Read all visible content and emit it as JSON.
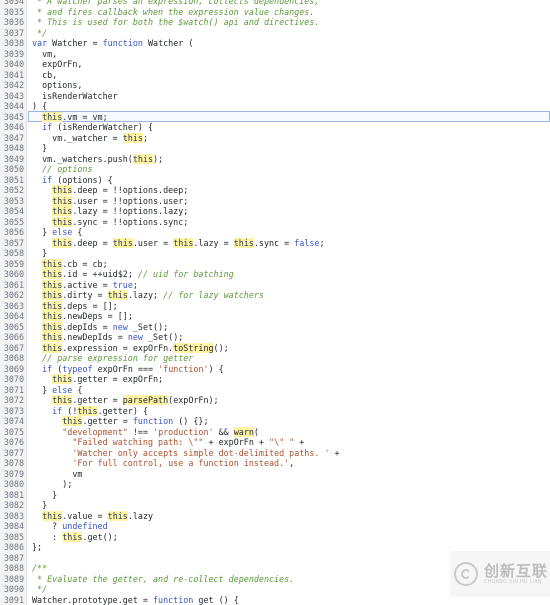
{
  "editor": {
    "lines": [
      {
        "num": "3034",
        "tokens": [
          [
            "t-comment",
            " * A watcher parses an expression, collects dependencies,"
          ]
        ]
      },
      {
        "num": "3035",
        "tokens": [
          [
            "t-comment",
            " * and fires callback when the expression value changes."
          ]
        ]
      },
      {
        "num": "3036",
        "tokens": [
          [
            "t-comment",
            " * This is used for both the $watch() api and directives."
          ]
        ]
      },
      {
        "num": "3037",
        "tokens": [
          [
            "t-comment",
            " */"
          ]
        ]
      },
      {
        "num": "3038",
        "tokens": [
          [
            "t-kw",
            "var"
          ],
          [
            "t-plain",
            " Watcher = "
          ],
          [
            "t-kw",
            "function"
          ],
          [
            "t-plain",
            " Watcher ("
          ]
        ]
      },
      {
        "num": "3039",
        "tokens": [
          [
            "t-plain",
            "  vm,"
          ]
        ]
      },
      {
        "num": "3040",
        "tokens": [
          [
            "t-plain",
            "  expOrFn,"
          ]
        ]
      },
      {
        "num": "3041",
        "tokens": [
          [
            "t-plain",
            "  cb,"
          ]
        ]
      },
      {
        "num": "3042",
        "tokens": [
          [
            "t-plain",
            "  options,"
          ]
        ]
      },
      {
        "num": "3043",
        "tokens": [
          [
            "t-plain",
            "  isRenderWatcher"
          ]
        ]
      },
      {
        "num": "3044",
        "tokens": [
          [
            "t-plain",
            ") {"
          ]
        ]
      },
      {
        "num": "3045",
        "hl": true,
        "tokens": [
          [
            "t-plain",
            "  "
          ],
          [
            "t-this",
            "this"
          ],
          [
            "t-plain",
            ".vm = vm;"
          ]
        ]
      },
      {
        "num": "3046",
        "tokens": [
          [
            "t-plain",
            "  "
          ],
          [
            "t-kw",
            "if"
          ],
          [
            "t-plain",
            " (isRenderWatcher) {"
          ]
        ]
      },
      {
        "num": "3047",
        "tokens": [
          [
            "t-plain",
            "    vm._watcher = "
          ],
          [
            "t-this",
            "this"
          ],
          [
            "t-plain",
            ";"
          ]
        ]
      },
      {
        "num": "3048",
        "tokens": [
          [
            "t-plain",
            "  }"
          ]
        ]
      },
      {
        "num": "3049",
        "tokens": [
          [
            "t-plain",
            "  vm._watchers.push("
          ],
          [
            "t-this",
            "this"
          ],
          [
            "t-plain",
            ");"
          ]
        ]
      },
      {
        "num": "3050",
        "tokens": [
          [
            "t-comment",
            "  // options"
          ]
        ]
      },
      {
        "num": "3051",
        "tokens": [
          [
            "t-plain",
            "  "
          ],
          [
            "t-kw",
            "if"
          ],
          [
            "t-plain",
            " (options) {"
          ]
        ]
      },
      {
        "num": "3052",
        "tokens": [
          [
            "t-plain",
            "    "
          ],
          [
            "t-this",
            "this"
          ],
          [
            "t-plain",
            ".deep = !!options.deep;"
          ]
        ]
      },
      {
        "num": "3053",
        "tokens": [
          [
            "t-plain",
            "    "
          ],
          [
            "t-this",
            "this"
          ],
          [
            "t-plain",
            ".user = !!options.user;"
          ]
        ]
      },
      {
        "num": "3054",
        "tokens": [
          [
            "t-plain",
            "    "
          ],
          [
            "t-this",
            "this"
          ],
          [
            "t-plain",
            ".lazy = !!options.lazy;"
          ]
        ]
      },
      {
        "num": "3055",
        "tokens": [
          [
            "t-plain",
            "    "
          ],
          [
            "t-this",
            "this"
          ],
          [
            "t-plain",
            ".sync = !!options.sync;"
          ]
        ]
      },
      {
        "num": "3056",
        "tokens": [
          [
            "t-plain",
            "  } "
          ],
          [
            "t-kw",
            "else"
          ],
          [
            "t-plain",
            " {"
          ]
        ]
      },
      {
        "num": "3057",
        "tokens": [
          [
            "t-plain",
            "    "
          ],
          [
            "t-this",
            "this"
          ],
          [
            "t-plain",
            ".deep = "
          ],
          [
            "t-this",
            "this"
          ],
          [
            "t-plain",
            ".user = "
          ],
          [
            "t-this",
            "this"
          ],
          [
            "t-plain",
            ".lazy = "
          ],
          [
            "t-this",
            "this"
          ],
          [
            "t-plain",
            ".sync = "
          ],
          [
            "t-kw",
            "false"
          ],
          [
            "t-plain",
            ";"
          ]
        ]
      },
      {
        "num": "3058",
        "tokens": [
          [
            "t-plain",
            "  }"
          ]
        ]
      },
      {
        "num": "3059",
        "tokens": [
          [
            "t-plain",
            "  "
          ],
          [
            "t-this",
            "this"
          ],
          [
            "t-plain",
            ".cb = cb;"
          ]
        ]
      },
      {
        "num": "3060",
        "tokens": [
          [
            "t-plain",
            "  "
          ],
          [
            "t-this",
            "this"
          ],
          [
            "t-plain",
            ".id = ++uid$2; "
          ],
          [
            "t-comment",
            "// uid for batching"
          ]
        ]
      },
      {
        "num": "3061",
        "tokens": [
          [
            "t-plain",
            "  "
          ],
          [
            "t-this",
            "this"
          ],
          [
            "t-plain",
            ".active = "
          ],
          [
            "t-kw",
            "true"
          ],
          [
            "t-plain",
            ";"
          ]
        ]
      },
      {
        "num": "3062",
        "tokens": [
          [
            "t-plain",
            "  "
          ],
          [
            "t-this",
            "this"
          ],
          [
            "t-plain",
            ".dirty = "
          ],
          [
            "t-this",
            "this"
          ],
          [
            "t-plain",
            ".lazy; "
          ],
          [
            "t-comment",
            "// for lazy watchers"
          ]
        ]
      },
      {
        "num": "3063",
        "tokens": [
          [
            "t-plain",
            "  "
          ],
          [
            "t-this",
            "this"
          ],
          [
            "t-plain",
            ".deps = [];"
          ]
        ]
      },
      {
        "num": "3064",
        "tokens": [
          [
            "t-plain",
            "  "
          ],
          [
            "t-this",
            "this"
          ],
          [
            "t-plain",
            ".newDeps = [];"
          ]
        ]
      },
      {
        "num": "3065",
        "tokens": [
          [
            "t-plain",
            "  "
          ],
          [
            "t-this",
            "this"
          ],
          [
            "t-plain",
            ".depIds = "
          ],
          [
            "t-kw",
            "new"
          ],
          [
            "t-plain",
            " _Set();"
          ]
        ]
      },
      {
        "num": "3066",
        "tokens": [
          [
            "t-plain",
            "  "
          ],
          [
            "t-this",
            "this"
          ],
          [
            "t-plain",
            ".newDepIds = "
          ],
          [
            "t-kw",
            "new"
          ],
          [
            "t-plain",
            " _Set();"
          ]
        ]
      },
      {
        "num": "3067",
        "tokens": [
          [
            "t-plain",
            "  "
          ],
          [
            "t-this",
            "this"
          ],
          [
            "t-plain",
            ".expression = expOrFn."
          ],
          [
            "t-fn",
            "toString"
          ],
          [
            "t-plain",
            "();"
          ]
        ]
      },
      {
        "num": "3068",
        "tokens": [
          [
            "t-comment",
            "  // parse expression for getter"
          ]
        ]
      },
      {
        "num": "3069",
        "tokens": [
          [
            "t-plain",
            "  "
          ],
          [
            "t-kw",
            "if"
          ],
          [
            "t-plain",
            " ("
          ],
          [
            "t-kw",
            "typeof"
          ],
          [
            "t-plain",
            " expOrFn === "
          ],
          [
            "t-str",
            "'function'"
          ],
          [
            "t-plain",
            ") {"
          ]
        ]
      },
      {
        "num": "3070",
        "tokens": [
          [
            "t-plain",
            "    "
          ],
          [
            "t-this",
            "this"
          ],
          [
            "t-plain",
            ".getter = expOrFn;"
          ]
        ]
      },
      {
        "num": "3071",
        "tokens": [
          [
            "t-plain",
            "  } "
          ],
          [
            "t-kw",
            "else"
          ],
          [
            "t-plain",
            " {"
          ]
        ]
      },
      {
        "num": "3072",
        "tokens": [
          [
            "t-plain",
            "    "
          ],
          [
            "t-this",
            "this"
          ],
          [
            "t-plain",
            ".getter = "
          ],
          [
            "t-fn",
            "parsePath"
          ],
          [
            "t-plain",
            "(expOrFn);"
          ]
        ]
      },
      {
        "num": "3073",
        "tokens": [
          [
            "t-plain",
            "    "
          ],
          [
            "t-kw",
            "if"
          ],
          [
            "t-plain",
            " (!"
          ],
          [
            "t-this",
            "this"
          ],
          [
            "t-plain",
            ".getter) {"
          ]
        ]
      },
      {
        "num": "3074",
        "tokens": [
          [
            "t-plain",
            "      "
          ],
          [
            "t-this",
            "this"
          ],
          [
            "t-plain",
            ".getter = "
          ],
          [
            "t-kw",
            "function"
          ],
          [
            "t-plain",
            " () {};"
          ]
        ]
      },
      {
        "num": "3075",
        "tokens": [
          [
            "t-plain",
            "      "
          ],
          [
            "t-str",
            "\"development\""
          ],
          [
            "t-plain",
            " !== "
          ],
          [
            "t-str",
            "'production'"
          ],
          [
            "t-plain",
            " && "
          ],
          [
            "t-fn",
            "warn"
          ],
          [
            "t-plain",
            "("
          ]
        ]
      },
      {
        "num": "3076",
        "tokens": [
          [
            "t-plain",
            "        "
          ],
          [
            "t-str",
            "\"Failed watching path: \\\"\""
          ],
          [
            "t-plain",
            " + expOrFn + "
          ],
          [
            "t-str",
            "\"\\\" \""
          ],
          [
            "t-plain",
            " +"
          ]
        ]
      },
      {
        "num": "3077",
        "tokens": [
          [
            "t-plain",
            "        "
          ],
          [
            "t-str",
            "'Watcher only accepts simple dot-delimited paths. '"
          ],
          [
            "t-plain",
            " +"
          ]
        ]
      },
      {
        "num": "3078",
        "tokens": [
          [
            "t-plain",
            "        "
          ],
          [
            "t-str",
            "'For full control, use a function instead.'"
          ],
          [
            "t-plain",
            ","
          ]
        ]
      },
      {
        "num": "3079",
        "tokens": [
          [
            "t-plain",
            "        vm"
          ]
        ]
      },
      {
        "num": "3080",
        "tokens": [
          [
            "t-plain",
            "      );"
          ]
        ]
      },
      {
        "num": "3081",
        "tokens": [
          [
            "t-plain",
            "    }"
          ]
        ]
      },
      {
        "num": "3082",
        "tokens": [
          [
            "t-plain",
            "  }"
          ]
        ]
      },
      {
        "num": "3083",
        "tokens": [
          [
            "t-plain",
            "  "
          ],
          [
            "t-this",
            "this"
          ],
          [
            "t-plain",
            ".value = "
          ],
          [
            "t-this",
            "this"
          ],
          [
            "t-plain",
            ".lazy"
          ]
        ]
      },
      {
        "num": "3084",
        "tokens": [
          [
            "t-plain",
            "    ? "
          ],
          [
            "t-kw",
            "undefined"
          ]
        ]
      },
      {
        "num": "3085",
        "tokens": [
          [
            "t-plain",
            "    : "
          ],
          [
            "t-this",
            "this"
          ],
          [
            "t-plain",
            ".get();"
          ]
        ]
      },
      {
        "num": "3086",
        "tokens": [
          [
            "t-plain",
            "};"
          ]
        ]
      },
      {
        "num": "3087",
        "tokens": [
          [
            "t-plain",
            ""
          ]
        ]
      },
      {
        "num": "3088",
        "tokens": [
          [
            "t-comment",
            "/**"
          ]
        ]
      },
      {
        "num": "3089",
        "tokens": [
          [
            "t-comment",
            " * Evaluate the getter, and re-collect dependencies."
          ]
        ]
      },
      {
        "num": "3090",
        "tokens": [
          [
            "t-comment",
            " */"
          ]
        ]
      },
      {
        "num": "3091",
        "tokens": [
          [
            "t-plain",
            "Watcher.prototype.get = "
          ],
          [
            "t-kw",
            "function"
          ],
          [
            "t-plain",
            " get () {"
          ]
        ]
      }
    ]
  },
  "watermark": {
    "brand_cn": "创新互联",
    "brand_en": "CHUANG XIN HU LIAN"
  }
}
